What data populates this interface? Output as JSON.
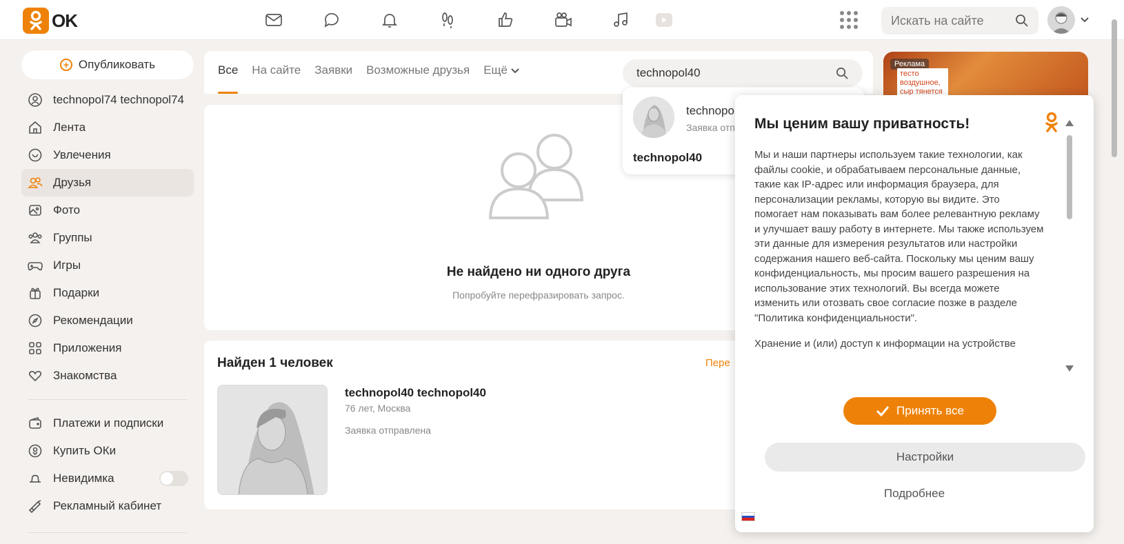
{
  "header": {
    "logo_text": "OK",
    "search_placeholder": "Искать на сайте",
    "nav_icons": [
      "mail-icon",
      "chat-icon",
      "bell-icon",
      "footprints-icon",
      "like-icon",
      "video-camera-icon",
      "music-icon",
      "video-play-icon"
    ]
  },
  "sidebar": {
    "publish_label": "Опубликовать",
    "items": [
      {
        "label": "technopol74 technopol74",
        "icon": "profile-icon"
      },
      {
        "label": "Лента",
        "icon": "home-icon"
      },
      {
        "label": "Увлечения",
        "icon": "hobby-icon"
      },
      {
        "label": "Друзья",
        "icon": "friends-icon",
        "active": true
      },
      {
        "label": "Фото",
        "icon": "photo-icon"
      },
      {
        "label": "Группы",
        "icon": "groups-icon"
      },
      {
        "label": "Игры",
        "icon": "gamepad-icon"
      },
      {
        "label": "Подарки",
        "icon": "gift-icon"
      },
      {
        "label": "Рекомендации",
        "icon": "compass-icon"
      },
      {
        "label": "Приложения",
        "icon": "apps-icon"
      },
      {
        "label": "Знакомства",
        "icon": "hearts-icon"
      }
    ],
    "items2": [
      {
        "label": "Платежи и подписки",
        "icon": "wallet-icon"
      },
      {
        "label": "Купить ОКи",
        "icon": "coin-icon"
      },
      {
        "label": "Невидимка",
        "icon": "hat-icon",
        "toggle": false
      },
      {
        "label": "Рекламный кабинет",
        "icon": "megaphone-icon"
      }
    ]
  },
  "tabs": {
    "items": [
      "Все",
      "На сайте",
      "Заявки",
      "Возможные друзья"
    ],
    "more": "Ещё",
    "active": "Все"
  },
  "friend_search": {
    "value": "technopol40"
  },
  "dropdown": {
    "name": "technopol",
    "status": "Заявка отп",
    "bottom": "technopol40"
  },
  "empty": {
    "title": "Не найдено ни одного друга",
    "subtitle": "Попробуйте перефразировать запрос."
  },
  "found": {
    "title": "Найден 1 человек",
    "link": "Пере",
    "person": {
      "name": "technopol40 technopol40",
      "meta": "76 лет, Москва",
      "status": "Заявка отправлена"
    }
  },
  "ad": {
    "badge": "Реклама",
    "text": "тесто воздушное, сыр тянется"
  },
  "consent": {
    "title": "Мы ценим вашу приватность!",
    "paragraph1": "Мы и наши партнеры используем такие технологии, как файлы cookie, и обрабатываем персональные данные, такие как IP-адрес или информация браузера, для персонализации рекламы, которую вы видите. Это помогает нам показывать вам более релевантную рекламу и улучшает вашу работу в интернете. Мы также используем эти данные для измерения результатов или настройки содержания нашего веб-сайта. Поскольку мы ценим вашу конфиденциальность, мы просим вашего разрешения на использование этих технологий. Вы всегда можете изменить или отозвать свое согласие позже в разделе \"Политика конфиденциальности\".",
    "paragraph2": "Хранение и (или) доступ к информации на устройстве",
    "accept_label": "Принять все",
    "settings_label": "Настройки",
    "more_label": "Подробнее"
  },
  "colors": {
    "accent": "#ee8208",
    "background": "#f4f1ee"
  }
}
